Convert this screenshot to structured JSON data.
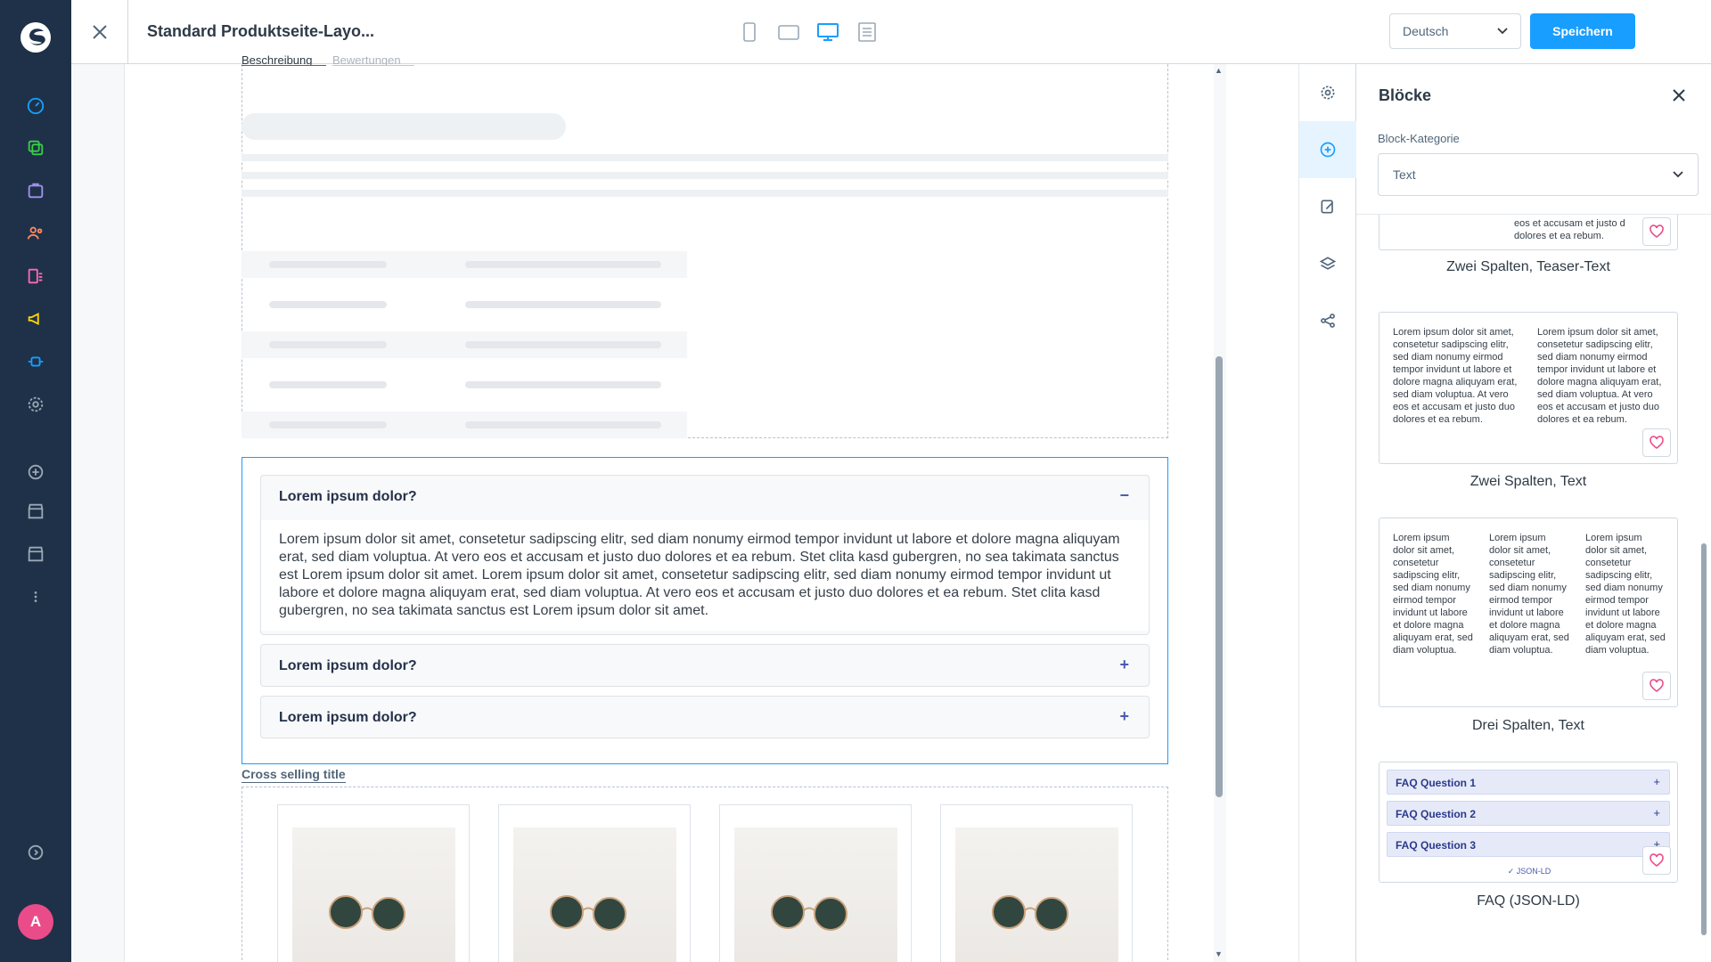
{
  "app": {
    "avatar_initial": "A",
    "brand_color": "#189eff",
    "nav_bg": "#1f3148"
  },
  "nav": {
    "icons": [
      "dashboard-icon",
      "catalog-icon",
      "orders-icon",
      "customers-icon",
      "content-icon",
      "marketing-icon",
      "extensions-icon",
      "settings-icon",
      "add-sales-channel-icon",
      "storefront-icon",
      "headless-icon",
      "more-icon",
      "expand-icon"
    ]
  },
  "header": {
    "title": "Standard Produktseite-Layo...",
    "language": "Deutsch",
    "save_label": "Speichern",
    "devices": [
      "mobile-icon",
      "tablet-icon",
      "desktop-icon",
      "form-view-icon"
    ],
    "active_device": "desktop"
  },
  "canvas": {
    "tabs_cut": "Beschreibung  Bewertungen",
    "faq": [
      {
        "question": "Lorem ipsum dolor?",
        "expanded": true,
        "answer": "Lorem ipsum dolor sit amet, consetetur sadipscing elitr, sed diam nonumy eirmod tempor invidunt ut labore et dolore magna aliquyam erat, sed diam voluptua. At vero eos et accusam et justo duo dolores et ea rebum. Stet clita kasd gubergren, no sea takimata sanctus est Lorem ipsum dolor sit amet. Lorem ipsum dolor sit amet, consetetur sadipscing elitr, sed diam nonumy eirmod tempor invidunt ut labore et dolore magna aliquyam erat, sed diam voluptua. At vero eos et accusam et justo duo dolores et ea rebum. Stet clita kasd gubergren, no sea takimata sanctus est Lorem ipsum dolor sit amet."
      },
      {
        "question": "Lorem ipsum dolor?",
        "expanded": false
      },
      {
        "question": "Lorem ipsum dolor?",
        "expanded": false
      }
    ],
    "cross_selling_title": "Cross selling title",
    "collapse_sign": "−",
    "expand_sign": "+"
  },
  "sidebar_tools": [
    "settings-icon",
    "add-block-icon",
    "edit-icon",
    "layers-icon",
    "share-icon"
  ],
  "blocks_panel": {
    "title": "Blöcke",
    "category_label": "Block-Kategorie",
    "category_value": "Text",
    "blocks": [
      {
        "name": "Zwei Spalten, Teaser-Text",
        "preview_cut": "eos et accusam et justo d\ndolores et ea rebum."
      },
      {
        "name": "Zwei Spalten, Text",
        "col_text": "Lorem ipsum dolor sit amet, consetetur sadipscing elitr, sed diam nonumy eirmod tempor invidunt ut labore et dolore magna aliquyam erat, sed diam voluptua. At vero eos et accusam et justo duo dolores et ea rebum."
      },
      {
        "name": "Drei Spalten, Text",
        "col_text": "Lorem ipsum dolor sit amet, consetetur sadipscing elitr, sed diam nonumy eirmod tempor invidunt ut labore et dolore magna aliquyam erat, sed diam voluptua."
      },
      {
        "name": "FAQ (JSON-LD)",
        "questions": [
          "FAQ Question 1",
          "FAQ Question 2",
          "FAQ Question 3"
        ],
        "badge": "✓ JSON-LD"
      }
    ]
  }
}
